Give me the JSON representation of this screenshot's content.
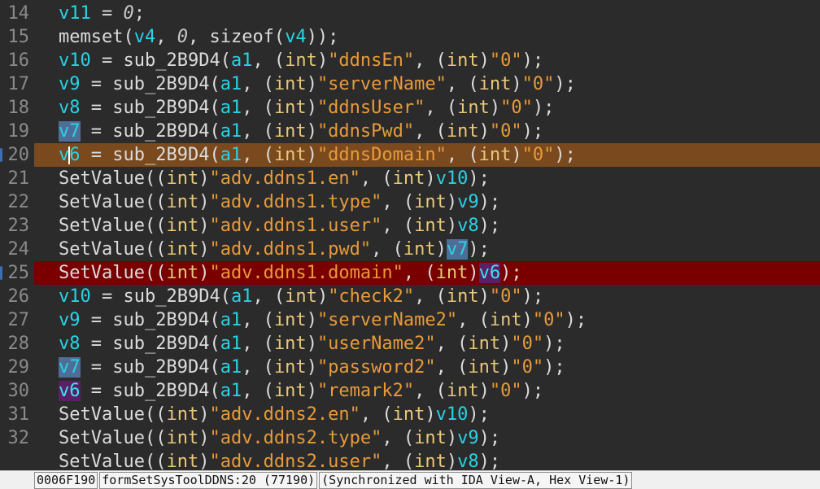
{
  "editor": {
    "lines": [
      {
        "num": "14",
        "highlight": "",
        "marked": false,
        "tokens": [
          {
            "t": "v11",
            "c": "var"
          },
          {
            "t": " = ",
            "c": "plain"
          },
          {
            "t": "0",
            "c": "num"
          },
          {
            "t": ";",
            "c": "plain"
          }
        ]
      },
      {
        "num": "15",
        "highlight": "",
        "marked": false,
        "tokens": [
          {
            "t": "memset(",
            "c": "plain"
          },
          {
            "t": "v4",
            "c": "var"
          },
          {
            "t": ", ",
            "c": "plain"
          },
          {
            "t": "0",
            "c": "num"
          },
          {
            "t": ", sizeof(",
            "c": "plain"
          },
          {
            "t": "v4",
            "c": "var"
          },
          {
            "t": "));",
            "c": "plain"
          }
        ]
      },
      {
        "num": "16",
        "highlight": "",
        "marked": false,
        "tokens": [
          {
            "t": "v10",
            "c": "var"
          },
          {
            "t": " = sub_2B9D4(",
            "c": "plain"
          },
          {
            "t": "a1",
            "c": "var"
          },
          {
            "t": ", (",
            "c": "plain"
          },
          {
            "t": "int",
            "c": "kw"
          },
          {
            "t": ")",
            "c": "plain"
          },
          {
            "t": "\"ddnsEn\"",
            "c": "str"
          },
          {
            "t": ", (",
            "c": "plain"
          },
          {
            "t": "int",
            "c": "kw"
          },
          {
            "t": ")",
            "c": "plain"
          },
          {
            "t": "\"0\"",
            "c": "str"
          },
          {
            "t": ");",
            "c": "plain"
          }
        ]
      },
      {
        "num": "17",
        "highlight": "",
        "marked": false,
        "tokens": [
          {
            "t": "v9",
            "c": "var"
          },
          {
            "t": " = sub_2B9D4(",
            "c": "plain"
          },
          {
            "t": "a1",
            "c": "var"
          },
          {
            "t": ", (",
            "c": "plain"
          },
          {
            "t": "int",
            "c": "kw"
          },
          {
            "t": ")",
            "c": "plain"
          },
          {
            "t": "\"serverName\"",
            "c": "str"
          },
          {
            "t": ", (",
            "c": "plain"
          },
          {
            "t": "int",
            "c": "kw"
          },
          {
            "t": ")",
            "c": "plain"
          },
          {
            "t": "\"0\"",
            "c": "str"
          },
          {
            "t": ");",
            "c": "plain"
          }
        ]
      },
      {
        "num": "18",
        "highlight": "",
        "marked": false,
        "tokens": [
          {
            "t": "v8",
            "c": "var"
          },
          {
            "t": " = sub_2B9D4(",
            "c": "plain"
          },
          {
            "t": "a1",
            "c": "var"
          },
          {
            "t": ", (",
            "c": "plain"
          },
          {
            "t": "int",
            "c": "kw"
          },
          {
            "t": ")",
            "c": "plain"
          },
          {
            "t": "\"ddnsUser\"",
            "c": "str"
          },
          {
            "t": ", (",
            "c": "plain"
          },
          {
            "t": "int",
            "c": "kw"
          },
          {
            "t": ")",
            "c": "plain"
          },
          {
            "t": "\"0\"",
            "c": "str"
          },
          {
            "t": ");",
            "c": "plain"
          }
        ]
      },
      {
        "num": "19",
        "highlight": "",
        "marked": false,
        "tokens": [
          {
            "t": "v7",
            "c": "selvar"
          },
          {
            "t": " = sub_2B9D4(",
            "c": "plain"
          },
          {
            "t": "a1",
            "c": "var"
          },
          {
            "t": ", (",
            "c": "plain"
          },
          {
            "t": "int",
            "c": "kw"
          },
          {
            "t": ")",
            "c": "plain"
          },
          {
            "t": "\"ddnsPwd\"",
            "c": "str"
          },
          {
            "t": ", (",
            "c": "plain"
          },
          {
            "t": "int",
            "c": "kw"
          },
          {
            "t": ")",
            "c": "plain"
          },
          {
            "t": "\"0\"",
            "c": "str"
          },
          {
            "t": ");",
            "c": "plain"
          }
        ]
      },
      {
        "num": "20",
        "highlight": "orange",
        "marked": true,
        "tokens": [
          {
            "t": "v",
            "c": "var"
          },
          {
            "t": "",
            "c": "caret"
          },
          {
            "t": "6",
            "c": "var"
          },
          {
            "t": " = sub_2B9D4(",
            "c": "plain"
          },
          {
            "t": "a1",
            "c": "var"
          },
          {
            "t": ", (",
            "c": "plain"
          },
          {
            "t": "int",
            "c": "kw"
          },
          {
            "t": ")",
            "c": "plain"
          },
          {
            "t": "\"ddnsDomain\"",
            "c": "str"
          },
          {
            "t": ", (",
            "c": "plain"
          },
          {
            "t": "int",
            "c": "kw"
          },
          {
            "t": ")",
            "c": "plain"
          },
          {
            "t": "\"0\"",
            "c": "str"
          },
          {
            "t": ");",
            "c": "plain"
          }
        ]
      },
      {
        "num": "21",
        "highlight": "",
        "marked": false,
        "tokens": [
          {
            "t": "SetValue((",
            "c": "plain"
          },
          {
            "t": "int",
            "c": "kw"
          },
          {
            "t": ")",
            "c": "plain"
          },
          {
            "t": "\"adv.ddns1.en\"",
            "c": "str"
          },
          {
            "t": ", (",
            "c": "plain"
          },
          {
            "t": "int",
            "c": "kw"
          },
          {
            "t": ")",
            "c": "plain"
          },
          {
            "t": "v10",
            "c": "var"
          },
          {
            "t": ");",
            "c": "plain"
          }
        ]
      },
      {
        "num": "22",
        "highlight": "",
        "marked": false,
        "tokens": [
          {
            "t": "SetValue((",
            "c": "plain"
          },
          {
            "t": "int",
            "c": "kw"
          },
          {
            "t": ")",
            "c": "plain"
          },
          {
            "t": "\"adv.ddns1.type\"",
            "c": "str"
          },
          {
            "t": ", (",
            "c": "plain"
          },
          {
            "t": "int",
            "c": "kw"
          },
          {
            "t": ")",
            "c": "plain"
          },
          {
            "t": "v9",
            "c": "var"
          },
          {
            "t": ");",
            "c": "plain"
          }
        ]
      },
      {
        "num": "23",
        "highlight": "",
        "marked": false,
        "tokens": [
          {
            "t": "SetValue((",
            "c": "plain"
          },
          {
            "t": "int",
            "c": "kw"
          },
          {
            "t": ")",
            "c": "plain"
          },
          {
            "t": "\"adv.ddns1.user\"",
            "c": "str"
          },
          {
            "t": ", (",
            "c": "plain"
          },
          {
            "t": "int",
            "c": "kw"
          },
          {
            "t": ")",
            "c": "plain"
          },
          {
            "t": "v8",
            "c": "var"
          },
          {
            "t": ");",
            "c": "plain"
          }
        ]
      },
      {
        "num": "24",
        "highlight": "",
        "marked": false,
        "tokens": [
          {
            "t": "SetValue((",
            "c": "plain"
          },
          {
            "t": "int",
            "c": "kw"
          },
          {
            "t": ")",
            "c": "plain"
          },
          {
            "t": "\"adv.ddns1.pwd\"",
            "c": "str"
          },
          {
            "t": ", (",
            "c": "plain"
          },
          {
            "t": "int",
            "c": "kw"
          },
          {
            "t": ")",
            "c": "plain"
          },
          {
            "t": "v7",
            "c": "selvar"
          },
          {
            "t": ");",
            "c": "plain"
          }
        ]
      },
      {
        "num": "25",
        "highlight": "red",
        "marked": true,
        "tokens": [
          {
            "t": "SetValue((",
            "c": "plain"
          },
          {
            "t": "int",
            "c": "kw"
          },
          {
            "t": ")",
            "c": "plain"
          },
          {
            "t": "\"adv.ddns1.domain\"",
            "c": "str"
          },
          {
            "t": ", (",
            "c": "plain"
          },
          {
            "t": "int",
            "c": "kw"
          },
          {
            "t": ")",
            "c": "plain"
          },
          {
            "t": "v6",
            "c": "selvar2"
          },
          {
            "t": ");",
            "c": "plain"
          }
        ]
      },
      {
        "num": "26",
        "highlight": "",
        "marked": false,
        "tokens": [
          {
            "t": "v10",
            "c": "var"
          },
          {
            "t": " = sub_2B9D4(",
            "c": "plain"
          },
          {
            "t": "a1",
            "c": "var"
          },
          {
            "t": ", (",
            "c": "plain"
          },
          {
            "t": "int",
            "c": "kw"
          },
          {
            "t": ")",
            "c": "plain"
          },
          {
            "t": "\"check2\"",
            "c": "str"
          },
          {
            "t": ", (",
            "c": "plain"
          },
          {
            "t": "int",
            "c": "kw"
          },
          {
            "t": ")",
            "c": "plain"
          },
          {
            "t": "\"0\"",
            "c": "str"
          },
          {
            "t": ");",
            "c": "plain"
          }
        ]
      },
      {
        "num": "27",
        "highlight": "",
        "marked": false,
        "tokens": [
          {
            "t": "v9",
            "c": "var"
          },
          {
            "t": " = sub_2B9D4(",
            "c": "plain"
          },
          {
            "t": "a1",
            "c": "var"
          },
          {
            "t": ", (",
            "c": "plain"
          },
          {
            "t": "int",
            "c": "kw"
          },
          {
            "t": ")",
            "c": "plain"
          },
          {
            "t": "\"serverName2\"",
            "c": "str"
          },
          {
            "t": ", (",
            "c": "plain"
          },
          {
            "t": "int",
            "c": "kw"
          },
          {
            "t": ")",
            "c": "plain"
          },
          {
            "t": "\"0\"",
            "c": "str"
          },
          {
            "t": ");",
            "c": "plain"
          }
        ]
      },
      {
        "num": "28",
        "highlight": "",
        "marked": false,
        "tokens": [
          {
            "t": "v8",
            "c": "var"
          },
          {
            "t": " = sub_2B9D4(",
            "c": "plain"
          },
          {
            "t": "a1",
            "c": "var"
          },
          {
            "t": ", (",
            "c": "plain"
          },
          {
            "t": "int",
            "c": "kw"
          },
          {
            "t": ")",
            "c": "plain"
          },
          {
            "t": "\"userName2\"",
            "c": "str"
          },
          {
            "t": ", (",
            "c": "plain"
          },
          {
            "t": "int",
            "c": "kw"
          },
          {
            "t": ")",
            "c": "plain"
          },
          {
            "t": "\"0\"",
            "c": "str"
          },
          {
            "t": ");",
            "c": "plain"
          }
        ]
      },
      {
        "num": "29",
        "highlight": "",
        "marked": false,
        "tokens": [
          {
            "t": "v7",
            "c": "selvar"
          },
          {
            "t": " = sub_2B9D4(",
            "c": "plain"
          },
          {
            "t": "a1",
            "c": "var"
          },
          {
            "t": ", (",
            "c": "plain"
          },
          {
            "t": "int",
            "c": "kw"
          },
          {
            "t": ")",
            "c": "plain"
          },
          {
            "t": "\"password2\"",
            "c": "str"
          },
          {
            "t": ", (",
            "c": "plain"
          },
          {
            "t": "int",
            "c": "kw"
          },
          {
            "t": ")",
            "c": "plain"
          },
          {
            "t": "\"0\"",
            "c": "str"
          },
          {
            "t": ");",
            "c": "plain"
          }
        ]
      },
      {
        "num": "30",
        "highlight": "",
        "marked": false,
        "tokens": [
          {
            "t": "v6",
            "c": "selvar2"
          },
          {
            "t": " = sub_2B9D4(",
            "c": "plain"
          },
          {
            "t": "a1",
            "c": "var"
          },
          {
            "t": ", (",
            "c": "plain"
          },
          {
            "t": "int",
            "c": "kw"
          },
          {
            "t": ")",
            "c": "plain"
          },
          {
            "t": "\"remark2\"",
            "c": "str"
          },
          {
            "t": ", (",
            "c": "plain"
          },
          {
            "t": "int",
            "c": "kw"
          },
          {
            "t": ")",
            "c": "plain"
          },
          {
            "t": "\"0\"",
            "c": "str"
          },
          {
            "t": ");",
            "c": "plain"
          }
        ]
      },
      {
        "num": "31",
        "highlight": "",
        "marked": false,
        "tokens": [
          {
            "t": "SetValue((",
            "c": "plain"
          },
          {
            "t": "int",
            "c": "kw"
          },
          {
            "t": ")",
            "c": "plain"
          },
          {
            "t": "\"adv.ddns2.en\"",
            "c": "str"
          },
          {
            "t": ", (",
            "c": "plain"
          },
          {
            "t": "int",
            "c": "kw"
          },
          {
            "t": ")",
            "c": "plain"
          },
          {
            "t": "v10",
            "c": "var"
          },
          {
            "t": ");",
            "c": "plain"
          }
        ]
      },
      {
        "num": "32",
        "highlight": "",
        "marked": false,
        "tokens": [
          {
            "t": "SetValue((",
            "c": "plain"
          },
          {
            "t": "int",
            "c": "kw"
          },
          {
            "t": ")",
            "c": "plain"
          },
          {
            "t": "\"adv.ddns2.type\"",
            "c": "str"
          },
          {
            "t": ", (",
            "c": "plain"
          },
          {
            "t": "int",
            "c": "kw"
          },
          {
            "t": ")",
            "c": "plain"
          },
          {
            "t": "v9",
            "c": "var"
          },
          {
            "t": ");",
            "c": "plain"
          }
        ]
      },
      {
        "num": "",
        "highlight": "",
        "marked": false,
        "tokens": [
          {
            "t": "SetValue((",
            "c": "plain"
          },
          {
            "t": "int",
            "c": "kw"
          },
          {
            "t": ")",
            "c": "plain"
          },
          {
            "t": "\"adv.ddns2.user\"",
            "c": "str"
          },
          {
            "t": ", (",
            "c": "plain"
          },
          {
            "t": "int",
            "c": "kw"
          },
          {
            "t": ")",
            "c": "plain"
          },
          {
            "t": "v8",
            "c": "var"
          },
          {
            "t": ");",
            "c": "plain"
          }
        ]
      }
    ]
  },
  "statusbar": {
    "address": "0006F190",
    "location": "formSetSysToolDDNS:20 (77190)",
    "sync": "(Synchronized with IDA View-A, Hex View-1)"
  },
  "colors": {
    "background": "#2b2b2b",
    "current_line": "#7a4a1e",
    "breakpoint_line": "#7a0000",
    "variable": "#29d2e6",
    "string": "#e89a3a",
    "keyword": "#e8c77a"
  }
}
